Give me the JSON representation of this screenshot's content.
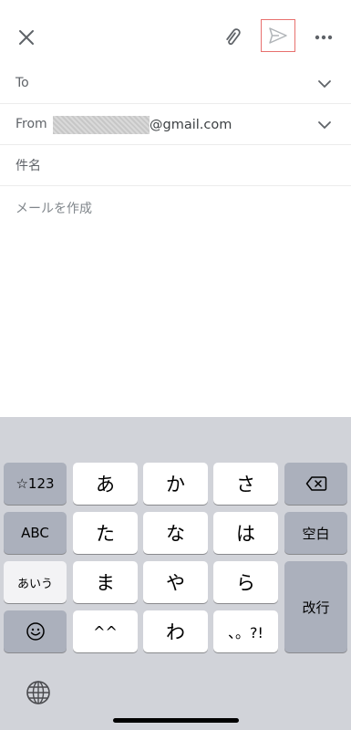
{
  "toolbar": {
    "close_icon": "close-icon",
    "attach_icon": "paperclip-icon",
    "send_icon": "send-icon",
    "more_icon": "more-horizontal-icon"
  },
  "fields": {
    "to_label": "To",
    "from_label": "From",
    "from_email_suffix": "@gmail.com",
    "subject_placeholder": "件名",
    "body_placeholder": "メールを作成"
  },
  "keyboard": {
    "row1": [
      "☆123",
      "あ",
      "か",
      "さ",
      "delete"
    ],
    "row2": [
      "ABC",
      "た",
      "な",
      "は",
      "空白"
    ],
    "row3": [
      "あいう",
      "ま",
      "や",
      "ら",
      "改行"
    ],
    "row4": [
      "emoji",
      "^^",
      "わ",
      "、。?!"
    ],
    "keys": {
      "symbols": "☆123",
      "a": "あ",
      "ka": "か",
      "sa": "さ",
      "abc": "ABC",
      "ta": "た",
      "na": "な",
      "ha": "は",
      "space": "空白",
      "aiu": "あいう",
      "ma": "ま",
      "ya": "や",
      "ra": "ら",
      "enter": "改行",
      "kaomoji": "^^",
      "wa": "わ",
      "punct": "、。?!"
    }
  },
  "colors": {
    "highlight": "#e8706e",
    "keyboard_bg": "#d1d3d9",
    "dark_key": "#abb0bc"
  }
}
